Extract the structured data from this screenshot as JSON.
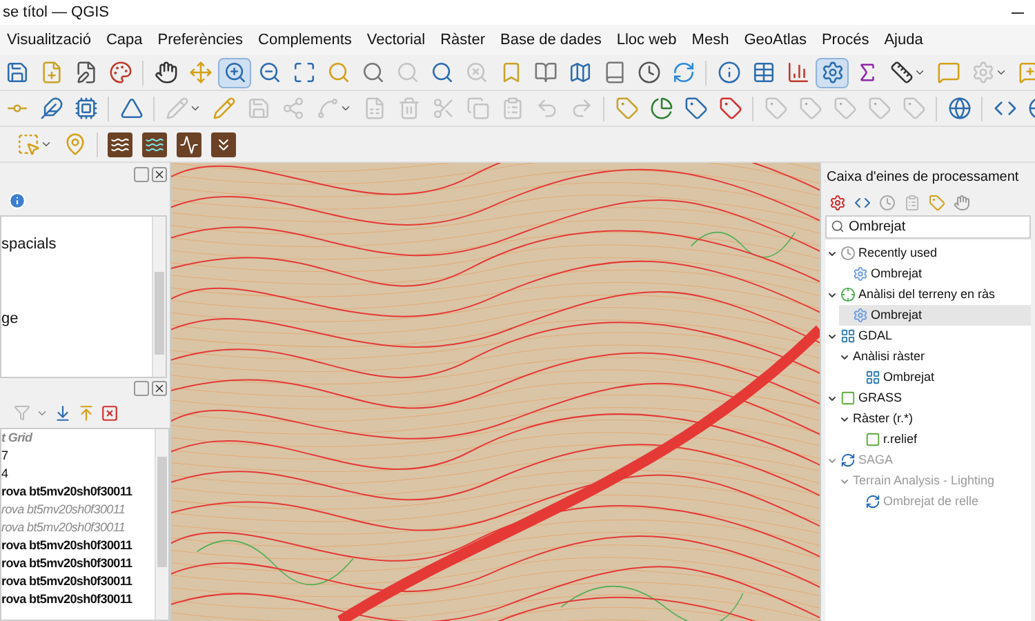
{
  "window": {
    "title": "se títol — QGIS"
  },
  "menu": [
    "Visualització",
    "Capa",
    "Preferències",
    "Complements",
    "Vectorial",
    "Ràster",
    "Base de dades",
    "Lloc web",
    "Mesh",
    "GeoAtlas",
    "Procés",
    "Ajuda"
  ],
  "toolbars": [
    [
      {
        "disabled": false,
        "selected": false
      },
      {
        "disabled": false,
        "selected": false
      },
      {
        "disabled": false,
        "selected": false
      },
      {
        "disabled": false,
        "selected": false
      },
      {
        "disabled": false,
        "selected": false
      },
      {
        "disabled": false,
        "selected": false
      },
      {
        "disabled": false,
        "selected": true
      },
      {
        "disabled": false,
        "selected": false
      },
      {
        "disabled": false,
        "selected": false
      },
      {
        "disabled": false,
        "selected": false
      },
      {
        "disabled": false,
        "selected": false
      },
      {
        "disabled": true,
        "selected": false
      },
      {
        "disabled": false,
        "selected": false
      },
      {
        "disabled": true,
        "selected": false
      },
      {
        "disabled": false,
        "selected": false
      },
      {
        "disabled": false,
        "selected": false
      },
      {
        "disabled": false,
        "selected": false
      },
      {
        "disabled": false,
        "selected": false
      },
      {
        "disabled": false,
        "selected": false
      },
      {
        "disabled": false,
        "selected": false
      },
      {
        "disabled": false,
        "selected": false
      },
      {
        "disabled": false,
        "selected": false
      },
      {
        "disabled": false,
        "selected": false
      },
      {
        "disabled": false,
        "selected": true
      },
      {
        "disabled": false,
        "selected": false
      },
      {
        "disabled": false,
        "selected": false
      },
      {
        "disabled": false,
        "selected": false
      },
      {
        "disabled": true,
        "selected": false
      },
      {
        "disabled": false,
        "selected": false
      }
    ],
    [
      {
        "disabled": false,
        "selected": false
      },
      {
        "disabled": false,
        "selected": false
      },
      {
        "disabled": false,
        "selected": false
      },
      {
        "disabled": false,
        "selected": false
      },
      {
        "disabled": true,
        "selected": false
      },
      {
        "disabled": false,
        "selected": false
      },
      {
        "disabled": true,
        "selected": false
      },
      {
        "disabled": true,
        "selected": false
      },
      {
        "disabled": true,
        "selected": false
      },
      {
        "disabled": true,
        "selected": false
      },
      {
        "disabled": true,
        "selected": false
      },
      {
        "disabled": true,
        "selected": false
      },
      {
        "disabled": true,
        "selected": false
      },
      {
        "disabled": true,
        "selected": false
      },
      {
        "disabled": true,
        "selected": false
      },
      {
        "disabled": true,
        "selected": false
      },
      {
        "disabled": false,
        "selected": false
      },
      {
        "disabled": false,
        "selected": false
      },
      {
        "disabled": false,
        "selected": false
      },
      {
        "disabled": false,
        "selected": false
      },
      {
        "disabled": true,
        "selected": false
      },
      {
        "disabled": true,
        "selected": false
      },
      {
        "disabled": true,
        "selected": false
      },
      {
        "disabled": true,
        "selected": false
      },
      {
        "disabled": true,
        "selected": false
      },
      {
        "disabled": false,
        "selected": false
      },
      {
        "disabled": false,
        "selected": false
      },
      {
        "disabled": false,
        "selected": false
      }
    ],
    [
      {
        "disabled": false,
        "selected": false
      },
      {
        "disabled": false,
        "selected": false
      },
      {
        "disabled": false,
        "selected": false
      },
      {
        "disabled": false,
        "selected": false
      },
      {
        "disabled": false,
        "selected": false
      },
      {
        "disabled": false,
        "selected": false
      }
    ]
  ],
  "browser_panel": {
    "items": [
      "spacials",
      "ge"
    ]
  },
  "layers_panel": {
    "rows": [
      {
        "kind": "group",
        "text": "t Grid"
      },
      {
        "kind": "plain",
        "text": "7"
      },
      {
        "kind": "plain",
        "text": "4"
      },
      {
        "kind": "layer",
        "text": "rova bt5mv20sh0f30011"
      },
      {
        "kind": "inactive",
        "text": "rova bt5mv20sh0f30011"
      },
      {
        "kind": "inactive",
        "text": "rova bt5mv20sh0f30011"
      },
      {
        "kind": "layer",
        "text": "rova bt5mv20sh0f30011"
      },
      {
        "kind": "layer",
        "text": "rova bt5mv20sh0f30011"
      },
      {
        "kind": "layer",
        "text": "rova bt5mv20sh0f30011"
      },
      {
        "kind": "layer",
        "text": "rova bt5mv20sh0f30011"
      }
    ]
  },
  "processing": {
    "title": "Caixa d'eines de processament",
    "search": {
      "value": "Ombrejat"
    },
    "tree": [
      {
        "label": "Recently used",
        "expanded": true,
        "disabled": false,
        "children": [
          {
            "label": "Ombrejat",
            "selected": false,
            "disabled": false
          }
        ]
      },
      {
        "label": "Anàlisi del terreny en ràs",
        "expanded": true,
        "disabled": false,
        "children": [
          {
            "label": "Ombrejat",
            "selected": true,
            "disabled": false
          }
        ]
      },
      {
        "label": "GDAL",
        "expanded": true,
        "disabled": false,
        "children": [
          {
            "label": "Anàlisi ràster",
            "expanded": true,
            "disabled": false,
            "children": [
              {
                "label": "Ombrejat",
                "selected": false,
                "disabled": false
              }
            ]
          }
        ]
      },
      {
        "label": "GRASS",
        "expanded": true,
        "disabled": false,
        "children": [
          {
            "label": "Ràster (r.*)",
            "expanded": true,
            "disabled": false,
            "children": [
              {
                "label": "r.relief",
                "selected": false,
                "disabled": false
              }
            ]
          }
        ]
      },
      {
        "label": "SAGA",
        "expanded": true,
        "disabled": true,
        "children": [
          {
            "label": "Terrain Analysis - Lighting",
            "expanded": true,
            "disabled": true,
            "children": [
              {
                "label": "Ombrejat de relle",
                "selected": false,
                "disabled": true
              }
            ]
          }
        ]
      }
    ]
  }
}
